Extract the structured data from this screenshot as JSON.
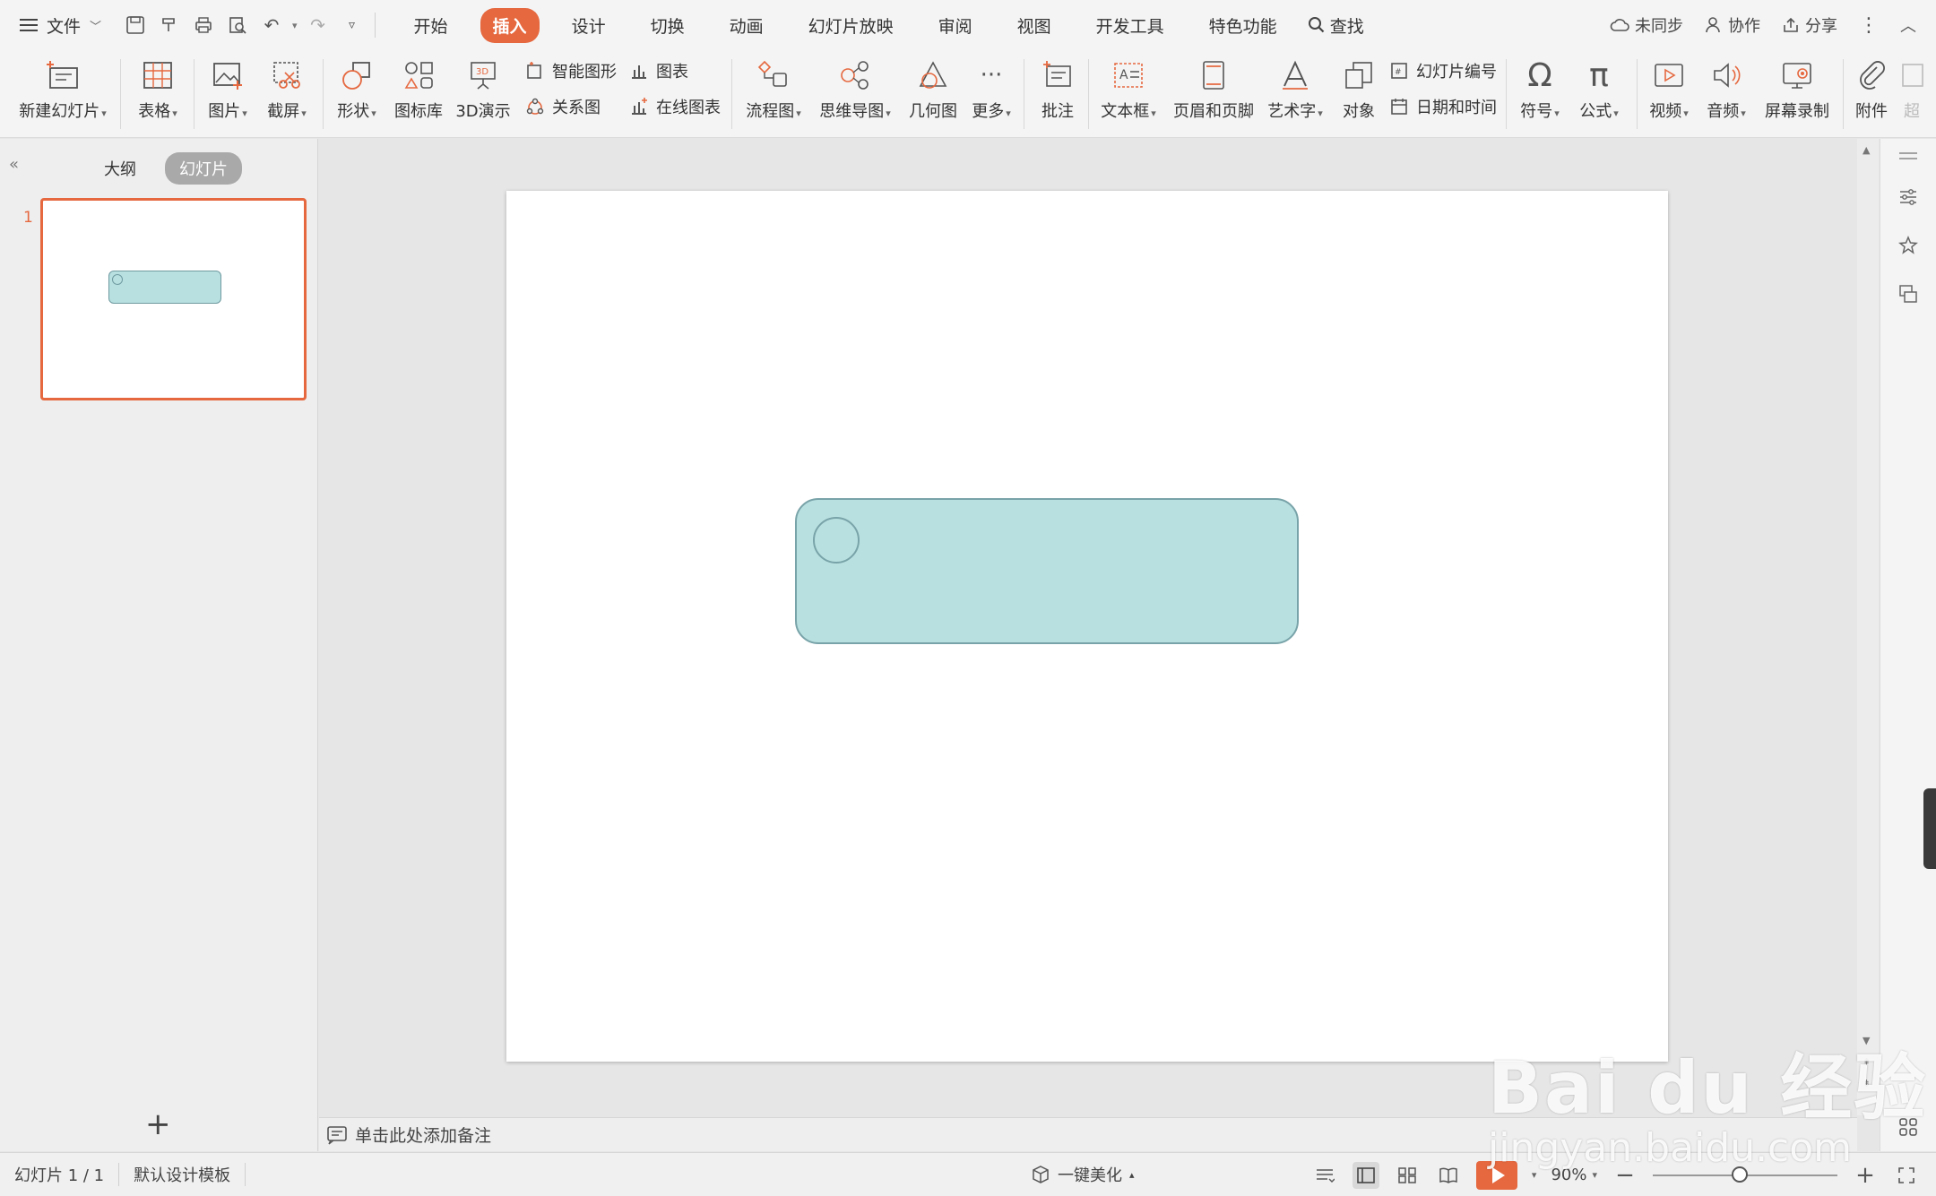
{
  "menu": {
    "file_label": "文件",
    "tabs": [
      "开始",
      "插入",
      "设计",
      "切换",
      "动画",
      "幻灯片放映",
      "审阅",
      "视图",
      "开发工具",
      "特色功能"
    ],
    "active_tab": "插入",
    "search_label": "查找",
    "sync_label": "未同步",
    "collab_label": "协作",
    "share_label": "分享"
  },
  "ribbon": {
    "new_slide": "新建幻灯片",
    "table": "表格",
    "picture": "图片",
    "screenshot": "截屏",
    "shape": "形状",
    "icon_lib": "图标库",
    "demo3d": "3D演示",
    "smart_shape": "智能图形",
    "chart": "图表",
    "relation": "关系图",
    "online_chart": "在线图表",
    "flowchart": "流程图",
    "mindmap": "思维导图",
    "geometry": "几何图",
    "more": "更多",
    "comment": "批注",
    "textbox": "文本框",
    "header_footer": "页眉和页脚",
    "wordart": "艺术字",
    "object": "对象",
    "slide_number": "幻灯片编号",
    "datetime": "日期和时间",
    "symbol": "符号",
    "formula": "公式",
    "video": "视频",
    "audio": "音频",
    "screen_record": "屏幕录制",
    "attachment": "附件",
    "super": "超"
  },
  "left_panel": {
    "outline_tab": "大纲",
    "slides_tab": "幻灯片",
    "slide_number": "1"
  },
  "notes": {
    "placeholder": "单击此处添加备注"
  },
  "status": {
    "slide_count": "幻灯片 1 / 1",
    "template": "默认设计模板",
    "beautify": "一键美化",
    "zoom": "90%",
    "zoom_level_percent": 90
  },
  "watermark": {
    "brand": "Bai du 经验",
    "url": "jingyan.baidu.com"
  },
  "colors": {
    "accent": "#e5683f",
    "shape_fill": "#b9e0e1",
    "shape_stroke": "#78a3a8"
  }
}
